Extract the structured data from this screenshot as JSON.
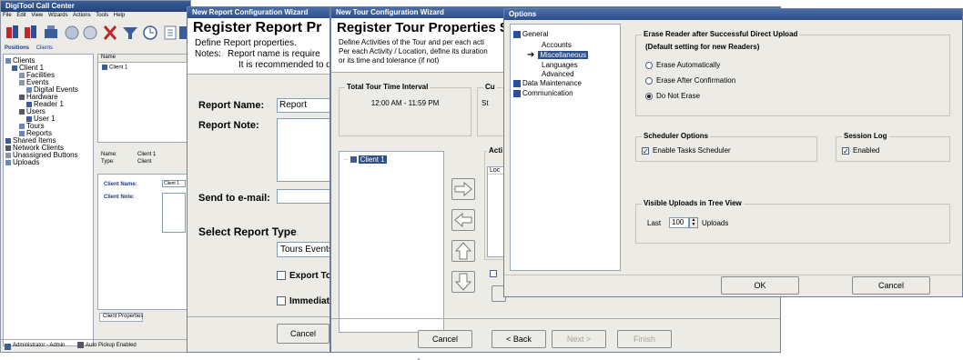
{
  "app_window": {
    "title": "DigiTool Call Center",
    "menu": [
      "File",
      "Edit",
      "View",
      "Wizards",
      "Actions",
      "Tools",
      "Help"
    ],
    "tabs": [
      "Positions",
      "Clients"
    ],
    "tree": [
      "Clients",
      "Client 1",
      "Facilities",
      "Events",
      "Digital Events",
      "Hardware",
      "Reader 1",
      "Users",
      "User 1",
      "Tours",
      "Reports",
      "Shared Items",
      "Network Clients",
      "Unassigned Buttons",
      "Uploads"
    ],
    "list_header": "Name",
    "list_item": "Client 1",
    "info": {
      "name_label": "Name:",
      "name_value": "Client 1",
      "type_label": "Type:",
      "type_value": "Client"
    },
    "form": {
      "client_name_label": "Client Name:",
      "client_name_value": "Client 1",
      "client_note_label": "Client Note:"
    },
    "properties_tab": "Client Properties",
    "status": {
      "user": "Administrator - Admin",
      "pickup": "Auto Pickup Enabled"
    }
  },
  "report_wizard": {
    "title": "New Report Configuration Wizard",
    "heading": "Register Report Pr",
    "desc": "Define Report properties.",
    "notes_label": "Notes:",
    "notes_line1": "Report name is require",
    "notes_line2": "It is recommended to d",
    "name_label": "Report Name:",
    "name_value": "Report",
    "note_label": "Report Note:",
    "email_label": "Send to e-mail:",
    "type_heading": "Select Report Type",
    "type_value": "Tours Events",
    "export_label": "Export To",
    "immediate_label": "Immediat",
    "cancel": "Cancel"
  },
  "tour_wizard": {
    "title": "New Tour Configuration Wizard",
    "heading": "Register Tour Properties S",
    "desc1": "Define Activities of the Tour and per each acti",
    "desc2": "Per each Activity / Location, define its duration",
    "desc3": "or its time and tolerance (if not)",
    "interval_label": "Total Tour Time Interval",
    "interval_value": "12:00 AM - 11:59 PM",
    "cu_label": "Cu",
    "st_label": "St",
    "acti_label": "Acti",
    "loc_label": "Loc",
    "client": "Client 1",
    "cancel": "Cancel",
    "back": "< Back",
    "next": "Next >",
    "finish": "Finish"
  },
  "options": {
    "title": "Options",
    "tree": {
      "general": "General",
      "accounts": "Accounts",
      "misc": "Miscellaneous",
      "languages": "Languages",
      "advanced": "Advanced",
      "data": "Data Maintenance",
      "comm": "Communication"
    },
    "erase": {
      "title": "Erase Reader after Successful Direct Upload",
      "subtitle": "(Default setting for new Readers)",
      "opt1": "Erase Automatically",
      "opt2": "Erase After Confirmation",
      "opt3": "Do Not Erase"
    },
    "scheduler": {
      "title": "Scheduler Options",
      "enable": "Enable Tasks Scheduler"
    },
    "session": {
      "title": "Session Log",
      "enabled": "Enabled"
    },
    "uploads": {
      "title": "Visible Uploads in Tree View",
      "last": "Last",
      "value": "100",
      "unit": "Uploads"
    },
    "ok": "OK",
    "cancel": "Cancel"
  }
}
